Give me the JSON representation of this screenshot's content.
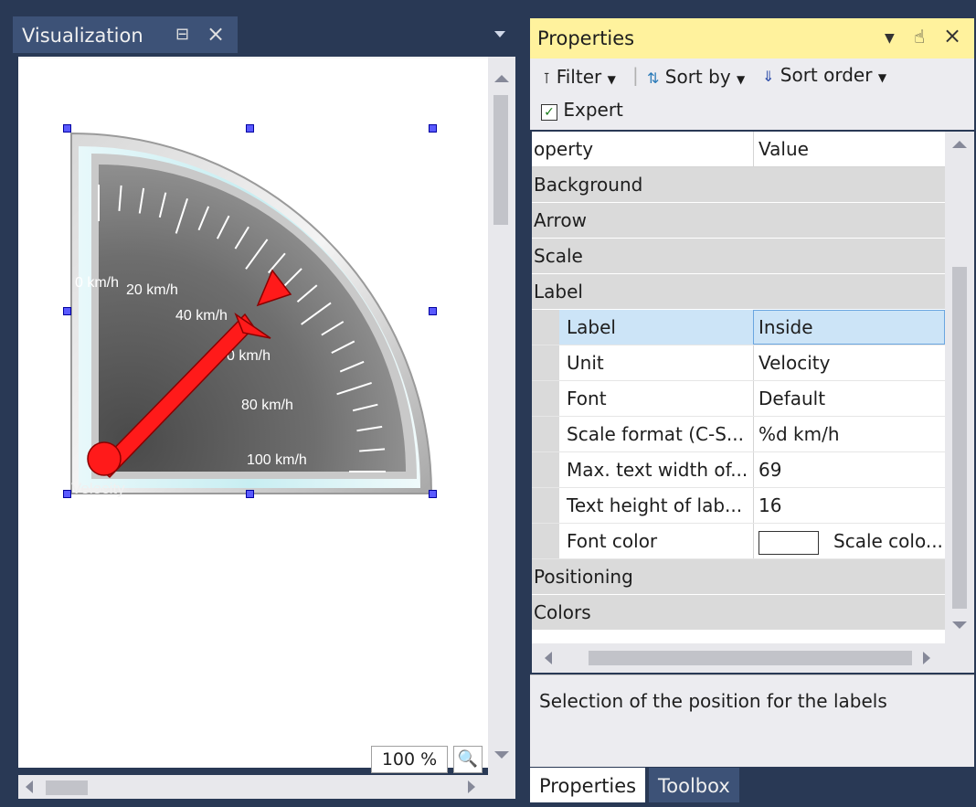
{
  "visualization": {
    "tab_title": "Visualization",
    "zoom": "100 %"
  },
  "gauge": {
    "scale_labels": [
      "0 km/h",
      "20 km/h",
      "40 km/h",
      "0 km/h",
      "80 km/h",
      "100 km/h"
    ],
    "unit_label": "Velocity",
    "needle_value": 40,
    "colors": {
      "needle": "#ff1a1a",
      "face": "#6c6c6c"
    }
  },
  "properties": {
    "title": "Properties",
    "toolbar": {
      "filter": "Filter",
      "sort_by": "Sort by",
      "sort_order": "Sort order",
      "expert": "Expert",
      "expert_checked": true
    },
    "columns": {
      "property": "operty",
      "value": "Value"
    },
    "categories_top": [
      "Background",
      "Arrow",
      "Scale",
      "Label"
    ],
    "label_rows": [
      {
        "name": "Label",
        "value": "Inside"
      },
      {
        "name": "Unit",
        "value": "Velocity"
      },
      {
        "name": "Font",
        "value": "Default"
      },
      {
        "name": "Scale format (C-S...",
        "value": "%d km/h"
      },
      {
        "name": "Max. text width of...",
        "value": "69"
      },
      {
        "name": "Text height of lab...",
        "value": "16"
      },
      {
        "name": "Font color",
        "value": "Scale colo..."
      }
    ],
    "categories_bottom": [
      "Positioning",
      "Colors"
    ],
    "description": "Selection of the position for the labels"
  },
  "bottom_tabs": [
    "Properties",
    "Toolbox"
  ]
}
